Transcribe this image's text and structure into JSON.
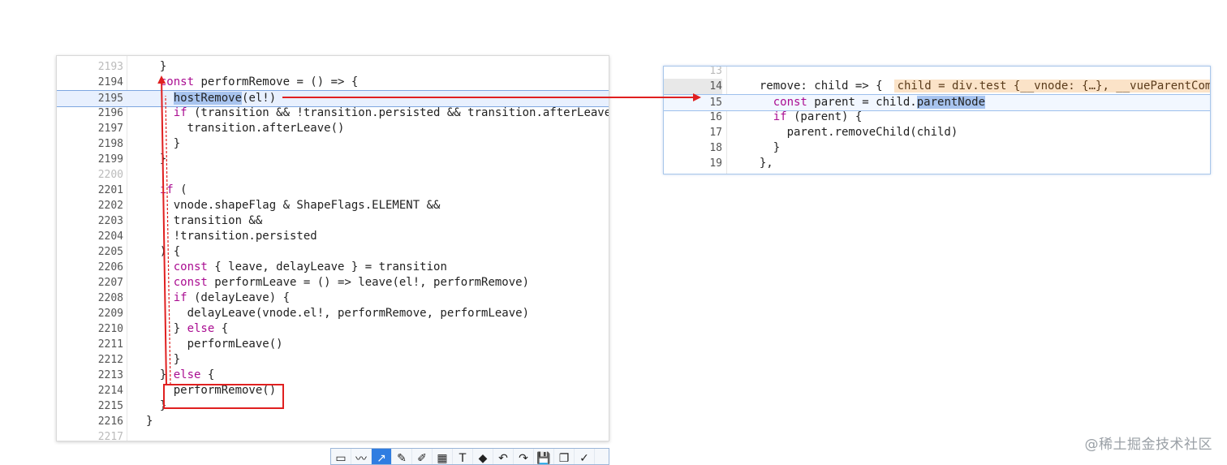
{
  "left_editor": {
    "lines": [
      {
        "n": "2193",
        "dim": true,
        "code": "  }"
      },
      {
        "n": "2194",
        "code": "  const performRemove = () => {"
      },
      {
        "n": "2195",
        "code": "    hostRemove(el!)"
      },
      {
        "n": "2196",
        "code": "    if (transition && !transition.persisted && transition.afterLeave) {"
      },
      {
        "n": "2197",
        "code": "      transition.afterLeave()"
      },
      {
        "n": "2198",
        "code": "    }"
      },
      {
        "n": "2199",
        "code": "  }"
      },
      {
        "n": "2200",
        "dim": true,
        "code": ""
      },
      {
        "n": "2201",
        "code": "  if ("
      },
      {
        "n": "2202",
        "code": "    vnode.shapeFlag & ShapeFlags.ELEMENT &&"
      },
      {
        "n": "2203",
        "code": "    transition &&"
      },
      {
        "n": "2204",
        "code": "    !transition.persisted"
      },
      {
        "n": "2205",
        "code": "  ) {"
      },
      {
        "n": "2206",
        "code": "    const { leave, delayLeave } = transition"
      },
      {
        "n": "2207",
        "code": "    const performLeave = () => leave(el!, performRemove)"
      },
      {
        "n": "2208",
        "code": "    if (delayLeave) {"
      },
      {
        "n": "2209",
        "code": "      delayLeave(vnode.el!, performRemove, performLeave)"
      },
      {
        "n": "2210",
        "code": "    } else {"
      },
      {
        "n": "2211",
        "code": "      performLeave()"
      },
      {
        "n": "2212",
        "code": "    }"
      },
      {
        "n": "2213",
        "code": "  } else {"
      },
      {
        "n": "2214",
        "code": "    performRemove()"
      },
      {
        "n": "2215",
        "code": "  }"
      },
      {
        "n": "2216",
        "code": "}"
      },
      {
        "n": "2217",
        "dim": true,
        "code": ""
      }
    ]
  },
  "right_editor": {
    "lines": [
      {
        "n": "13",
        "dim": true,
        "code": ""
      },
      {
        "n": "14",
        "code": "  remove: child => {"
      },
      {
        "n": "15",
        "code": "    const parent = child.parentNode"
      },
      {
        "n": "16",
        "code": "    if (parent) {"
      },
      {
        "n": "17",
        "code": "      parent.removeChild(child)"
      },
      {
        "n": "18",
        "code": "    }"
      },
      {
        "n": "19",
        "code": "  },"
      }
    ],
    "hover_value": "child = div.test {__vnode: {…}, __vueParentComponent: {…}}"
  },
  "toolbar": {
    "tools": [
      {
        "name": "rect-tool-icon",
        "glyph": "▭"
      },
      {
        "name": "curve-tool-icon",
        "glyph": "〰"
      },
      {
        "name": "arrow-tool-icon",
        "glyph": "↗",
        "active": true
      },
      {
        "name": "pen-tool-icon",
        "glyph": "✎"
      },
      {
        "name": "marker-tool-icon",
        "glyph": "✐"
      },
      {
        "name": "mosaic-tool-icon",
        "glyph": "▦"
      },
      {
        "name": "text-tool-icon",
        "glyph": "T"
      },
      {
        "name": "eraser-tool-icon",
        "glyph": "◆"
      },
      {
        "name": "undo-icon",
        "glyph": "↶"
      },
      {
        "name": "redo-icon",
        "glyph": "↷"
      },
      {
        "name": "save-icon",
        "glyph": "💾"
      },
      {
        "name": "copy-icon",
        "glyph": "❐"
      },
      {
        "name": "confirm-icon",
        "glyph": "✓"
      }
    ]
  },
  "watermark": "@稀土掘金技术社区",
  "colors": {
    "keyword": "#aa0d91",
    "annotation": "#e02020",
    "selection": "#a8c4ef"
  }
}
